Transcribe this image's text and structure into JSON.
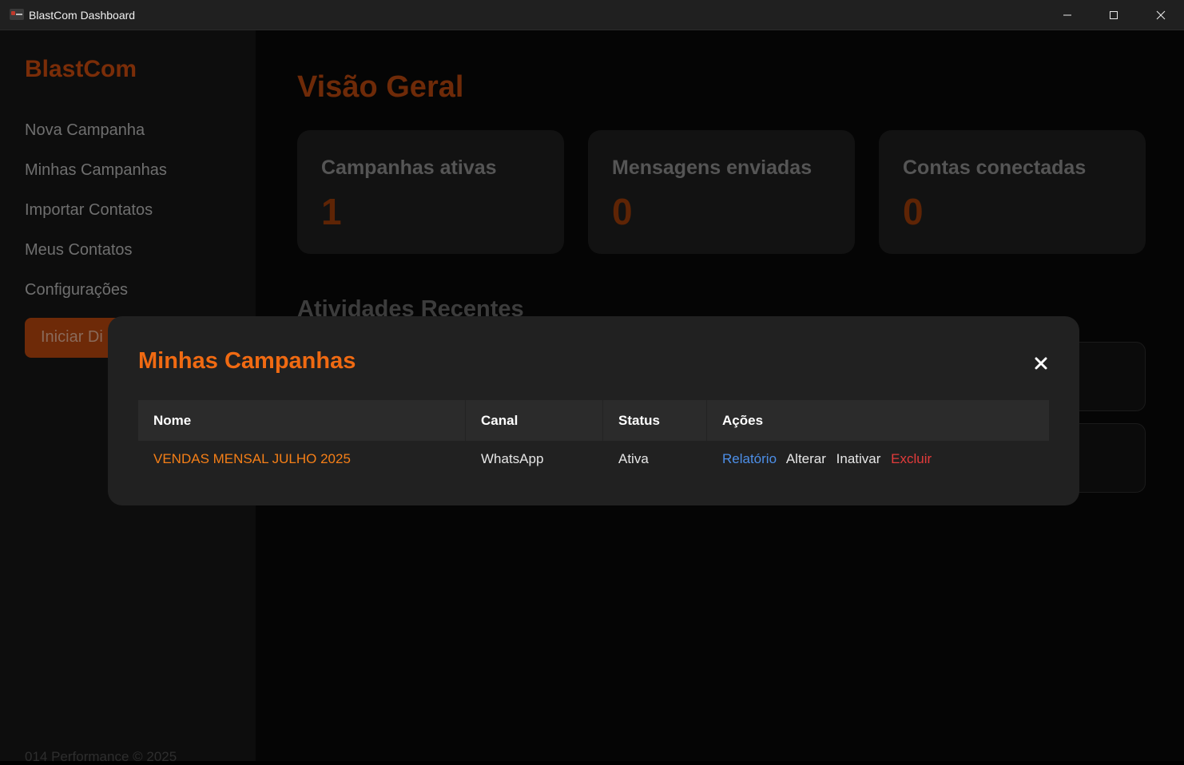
{
  "window": {
    "title": "BlastCom Dashboard"
  },
  "sidebar": {
    "brand": "BlastCom",
    "items": [
      {
        "label": "Nova Campanha"
      },
      {
        "label": "Minhas Campanhas"
      },
      {
        "label": "Importar Contatos"
      },
      {
        "label": "Meus Contatos"
      },
      {
        "label": "Configurações"
      }
    ],
    "start_button": "Iniciar Di",
    "footer": "014 Performance © 2025"
  },
  "main": {
    "title": "Visão Geral",
    "stats": [
      {
        "label": "Campanhas ativas",
        "value": "1"
      },
      {
        "label": "Mensagens enviadas",
        "value": "0"
      },
      {
        "label": "Contas conectadas",
        "value": "0"
      }
    ],
    "recent_title": "Atividades Recentes"
  },
  "modal": {
    "title": "Minhas Campanhas",
    "columns": [
      "Nome",
      "Canal",
      "Status",
      "Ações"
    ],
    "rows": [
      {
        "name": "VENDAS MENSAL JULHO 2025",
        "channel": "WhatsApp",
        "status": "Ativa",
        "actions": {
          "report": "Relatório",
          "edit": "Alterar",
          "inactivate": "Inativar",
          "delete": "Excluir"
        }
      }
    ]
  },
  "colors": {
    "accent": "#f06a12",
    "link": "#4d8fe8",
    "danger": "#e23b3b"
  }
}
